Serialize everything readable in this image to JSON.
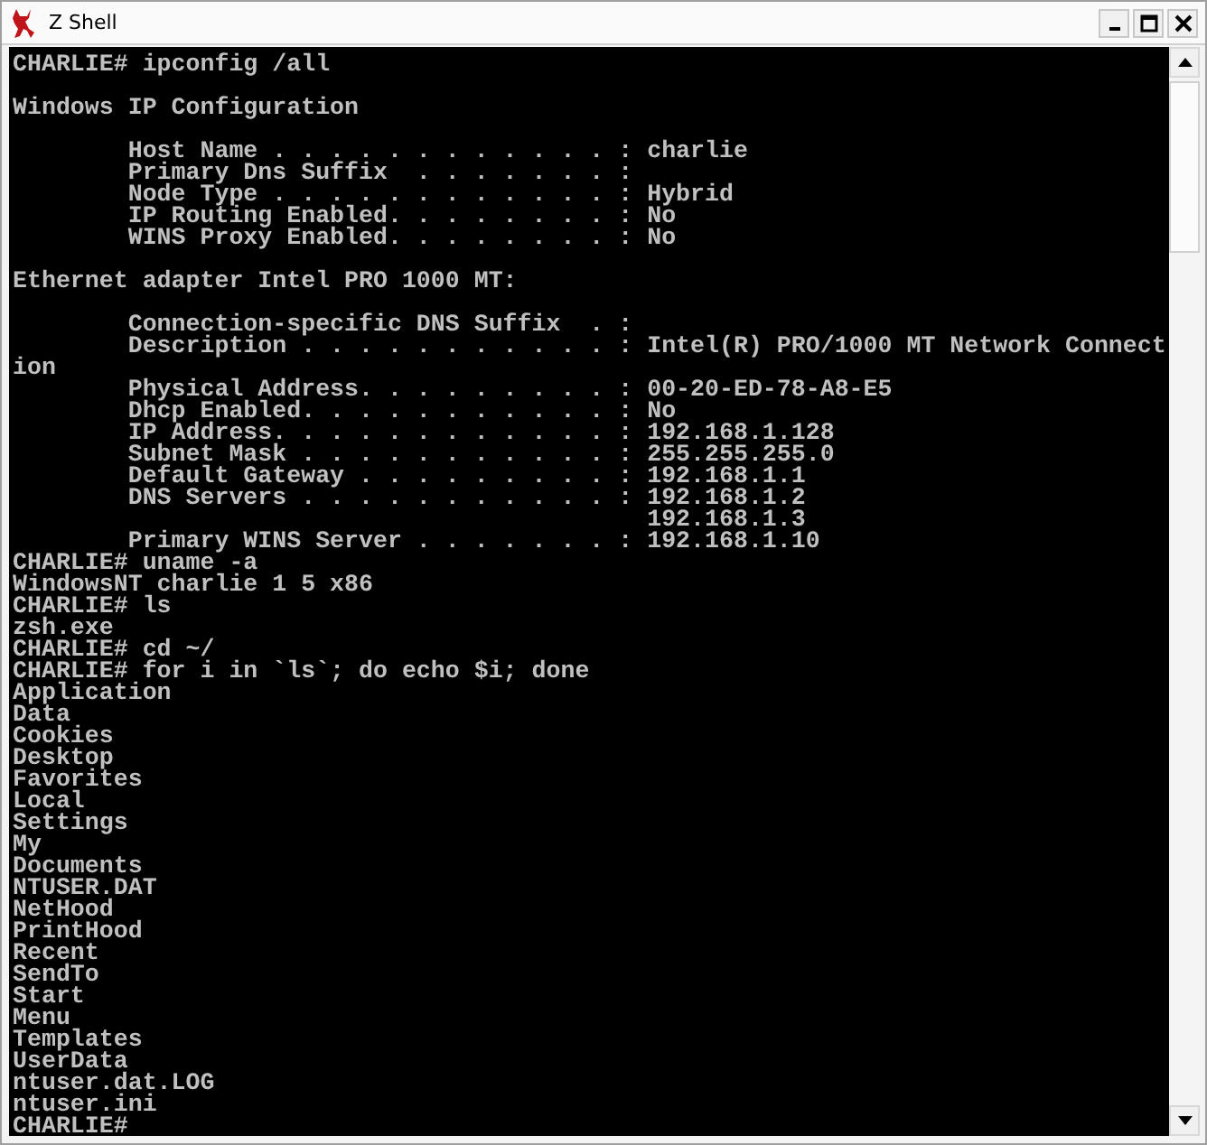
{
  "window": {
    "title": "Z Shell"
  },
  "terminal": {
    "blocks": [
      [
        "CHARLIE# ipconfig /all"
      ],
      [
        "Windows IP Configuration"
      ],
      [
        "        Host Name . . . . . . . . . . . . : charlie",
        "        Primary Dns Suffix  . . . . . . . :",
        "        Node Type . . . . . . . . . . . . : Hybrid",
        "        IP Routing Enabled. . . . . . . . : No",
        "        WINS Proxy Enabled. . . . . . . . : No"
      ],
      [
        "Ethernet adapter Intel PRO 1000 MT:"
      ],
      [
        "        Connection-specific DNS Suffix  . :",
        "        Description . . . . . . . . . . . : Intel(R) PRO/1000 MT Network Connect",
        "ion",
        "        Physical Address. . . . . . . . . : 00-20-ED-78-A8-E5",
        "        Dhcp Enabled. . . . . . . . . . . : No",
        "        IP Address. . . . . . . . . . . . : 192.168.1.128",
        "        Subnet Mask . . . . . . . . . . . : 255.255.255.0",
        "        Default Gateway . . . . . . . . . : 192.168.1.1",
        "        DNS Servers . . . . . . . . . . . : 192.168.1.2",
        "                                            192.168.1.3",
        "        Primary WINS Server . . . . . . . : 192.168.1.10",
        "CHARLIE# uname -a",
        "WindowsNT charlie 1 5 x86",
        "CHARLIE# ls",
        "zsh.exe",
        "CHARLIE# cd ~/",
        "CHARLIE# for i in `ls`; do echo $i; done",
        "Application",
        "Data",
        "Cookies",
        "Desktop",
        "Favorites",
        "Local",
        "Settings",
        "My",
        "Documents",
        "NTUSER.DAT",
        "NetHood",
        "PrintHood",
        "Recent",
        "SendTo",
        "Start",
        "Menu",
        "Templates",
        "UserData",
        "ntuser.dat.LOG",
        "ntuser.ini",
        "CHARLIE#"
      ]
    ]
  }
}
